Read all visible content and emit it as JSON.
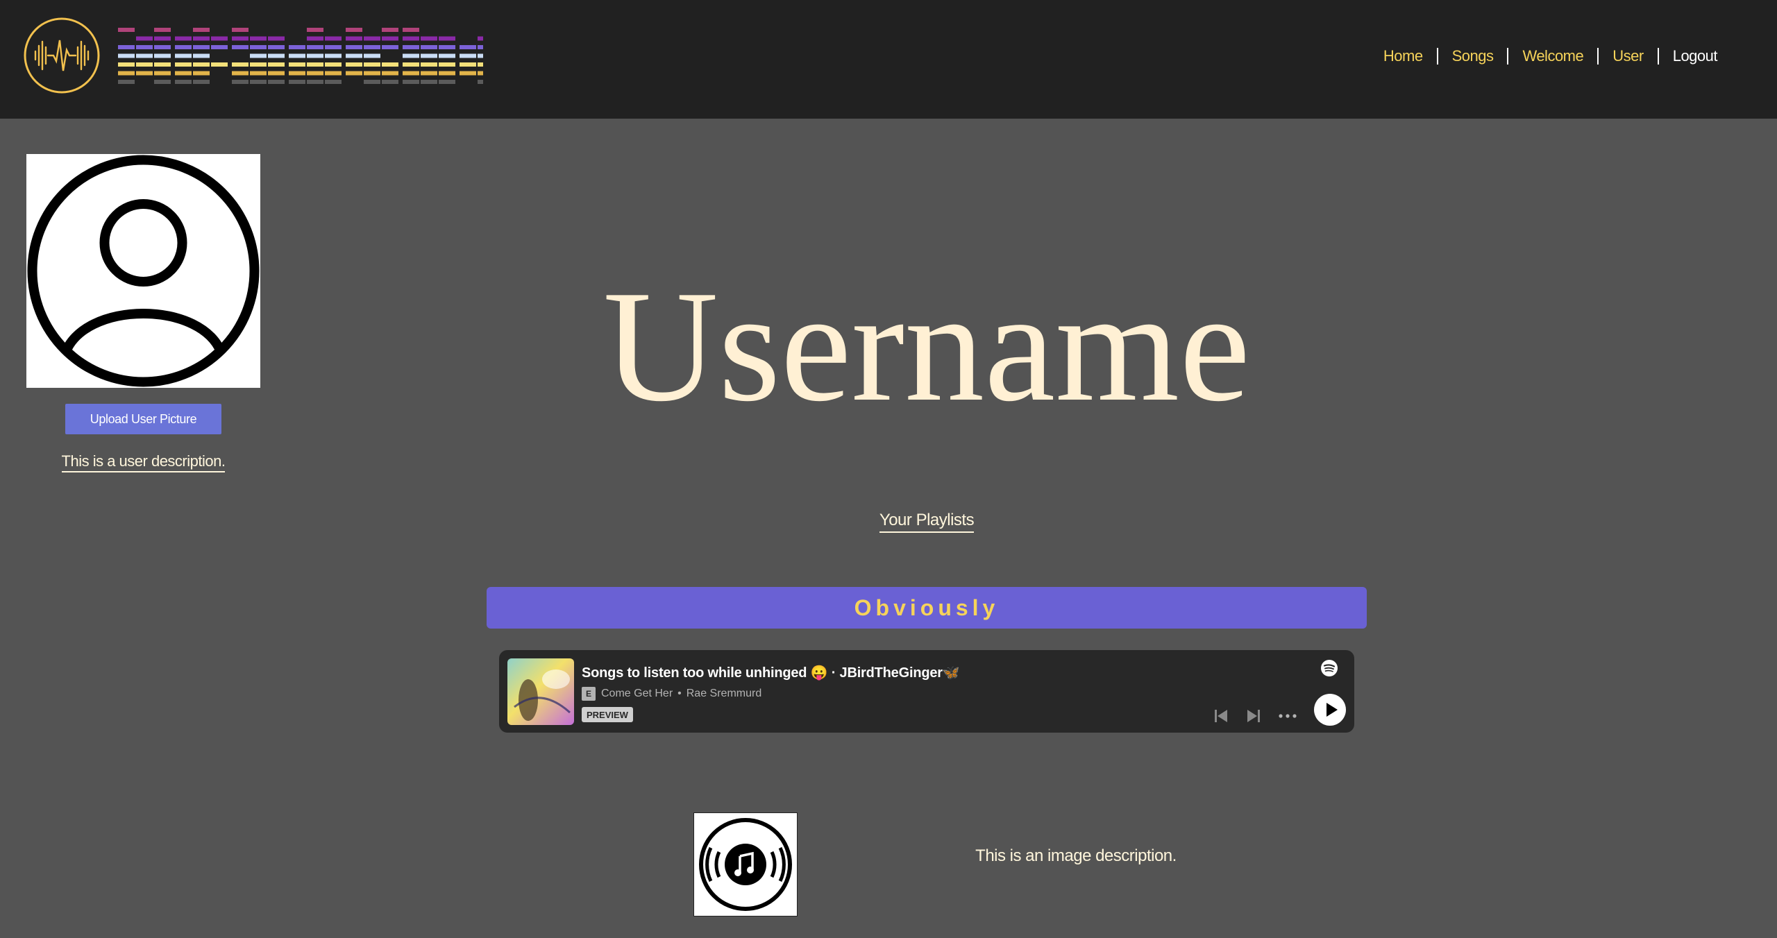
{
  "header": {
    "nav": [
      {
        "label": "Home",
        "name": "nav-home"
      },
      {
        "label": "Songs",
        "name": "nav-songs"
      },
      {
        "label": "Welcome",
        "name": "nav-welcome"
      },
      {
        "label": "User",
        "name": "nav-user"
      },
      {
        "label": "Logout",
        "name": "nav-logout"
      }
    ]
  },
  "profile": {
    "upload_label": "Upload User Picture",
    "description": "This is a user description.",
    "username": "Username"
  },
  "playlists": {
    "heading": "Your Playlists",
    "items": [
      {
        "name": "Obviously",
        "embed": {
          "title": "Songs to listen too while unhinged 😛 · JBirdTheGinger🦋",
          "explicit": "E",
          "song": "Come Get Her",
          "artist": "Rae Sremmurd",
          "badge": "PREVIEW"
        },
        "image_description": "This is an image description."
      }
    ]
  },
  "colors": {
    "header_bg": "#212121",
    "page_bg": "#545454",
    "accent_yellow": "#f6d35a",
    "playlist_bar": "#6a61d4",
    "upload_button": "#6a74d8",
    "title_cream": "#fff0d4"
  }
}
